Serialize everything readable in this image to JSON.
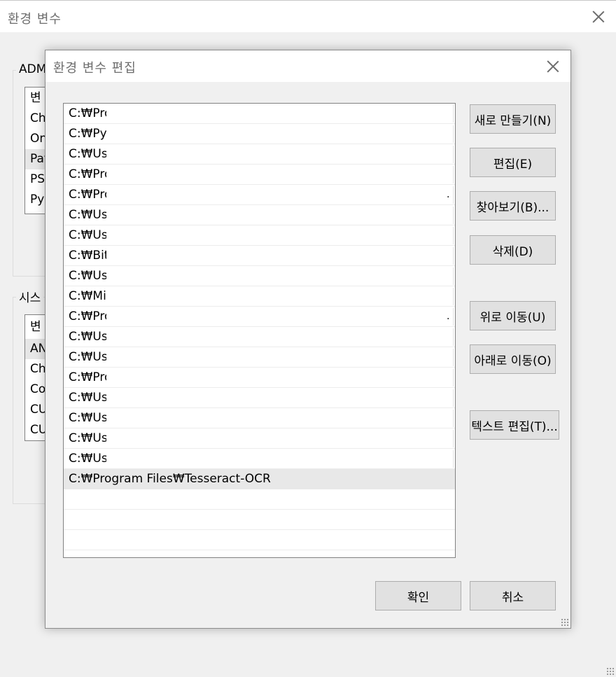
{
  "background_window": {
    "title": "환경 변수",
    "user_group_label": "ADM",
    "user_list": [
      "변",
      "Ch",
      "On",
      "Pat",
      "PS",
      "Py"
    ],
    "system_group_label": "시스",
    "system_list": [
      "변",
      "AN",
      "Ch",
      "Co",
      "CU",
      "CU"
    ]
  },
  "dialog": {
    "title": "환경 변수 편집",
    "entries": [
      "C:₩Pro",
      "C:₩Pyt",
      "C:₩Use",
      "C:₩Pro",
      "C:₩Pro",
      "C:₩Use",
      "C:₩Use",
      "C:₩Bitı",
      "C:₩Use",
      "C:₩Mir",
      "C:₩Pro",
      "C:₩Use",
      "C:₩Use",
      "C:₩Pro",
      "C:₩Use",
      "C:₩Use",
      "C:₩Use",
      "C:₩Use",
      "C:₩Program Files₩Tesseract-OCR"
    ],
    "selected_entry": "C:₩Program Files₩Tesseract-OCR",
    "buttons": {
      "new": "새로 만들기(N)",
      "edit": "편집(E)",
      "browse": "찾아보기(B)...",
      "delete": "삭제(D)",
      "move_up": "위로 이동(U)",
      "move_down": "아래로 이동(O)",
      "edit_text": "텍스트 편집(T)...",
      "ok": "확인",
      "cancel": "취소"
    }
  }
}
